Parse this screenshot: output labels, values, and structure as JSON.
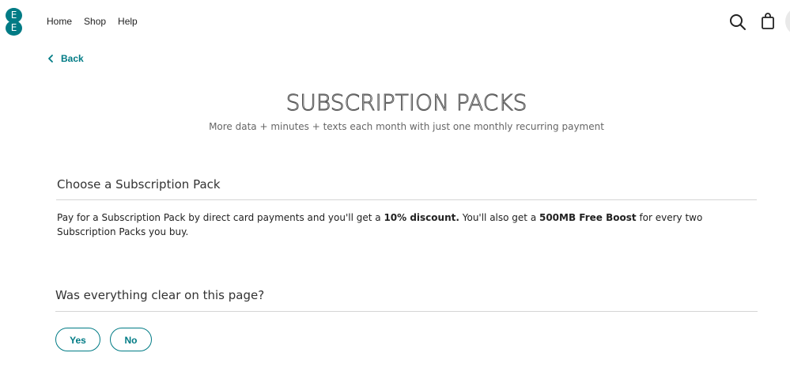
{
  "brand": {
    "logo_top_letter": "E",
    "logo_bottom_letter": "E",
    "color": "#007b85"
  },
  "nav": {
    "items": [
      {
        "label": "Home"
      },
      {
        "label": "Shop"
      },
      {
        "label": "Help"
      }
    ]
  },
  "header_icons": {
    "search": "search-icon",
    "bag": "shopping-bag-icon"
  },
  "back": {
    "label": "Back",
    "icon": "chevron-left-icon"
  },
  "hero": {
    "title": "SUBSCRIPTION PACKS",
    "subtitle": "More data + minutes + texts each month with just one monthly recurring payment"
  },
  "section": {
    "title": "Choose a Subscription Pack",
    "body_part1": "Pay for a Subscription Pack by direct card payments and you'll get a ",
    "body_bold1": "10% discount.",
    "body_part2": " You'll also get a ",
    "body_bold2": "500MB Free Boost",
    "body_part3": " for every two Subscription Packs you buy."
  },
  "feedback": {
    "question": "Was everything clear on this page?",
    "yes_label": "Yes",
    "no_label": "No"
  }
}
